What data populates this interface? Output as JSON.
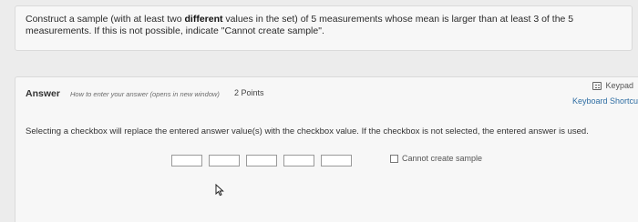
{
  "question": {
    "prefix": "Construct a sample (with at least two ",
    "bold": "different",
    "suffix": " values in the set) of 5 measurements whose mean is larger than at least 3 of the 5 measurements. If this is not possible, indicate \"Cannot create sample\"."
  },
  "answer": {
    "label": "Answer",
    "help_link": "How to enter your answer (opens in new window)",
    "points": "2 Points"
  },
  "toolbar": {
    "keypad_label": "Keypad",
    "keypad_icon": "keypad-icon",
    "keyboard_shortcuts": "Keyboard Shortcuts"
  },
  "instruction": "Selecting a checkbox will replace the entered answer value(s) with the checkbox value. If the checkbox is not selected, the entered answer is used.",
  "inputs": {
    "values": [
      "",
      "",
      "",
      "",
      ""
    ]
  },
  "checkbox": {
    "label": "Cannot create sample",
    "checked": false
  },
  "cursor_icon": "mouse-pointer-icon"
}
